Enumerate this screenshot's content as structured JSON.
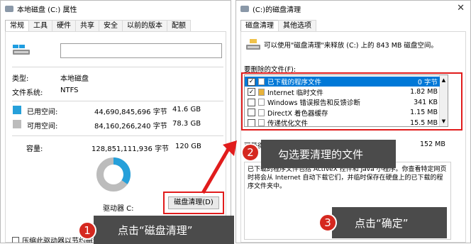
{
  "left_window": {
    "title": "本地磁盘 (C:) 属性",
    "tabs": [
      "常规",
      "工具",
      "硬件",
      "共享",
      "安全",
      "以前的版本",
      "配额"
    ],
    "drive_name_value": "",
    "type_label": "类型:",
    "type_value": "本地磁盘",
    "fs_label": "文件系统:",
    "fs_value": "NTFS",
    "used_label": "已用空间:",
    "used_bytes": "44,690,845,696 字节",
    "used_gb": "41.6 GB",
    "free_label": "可用空间:",
    "free_bytes": "84,160,266,240 字节",
    "free_gb": "78.3 GB",
    "capacity_label": "容量:",
    "capacity_bytes": "128,851,111,936 字节",
    "capacity_gb": "120 GB",
    "drive_label": "驱动器 C:",
    "cleanup_button": "磁盘清理(D)",
    "compress_label": "压缩此驱动器以节约磁盘空间(C)",
    "used_fraction": 0.347,
    "colors": {
      "used": "#26a0da",
      "free": "#bcbcbc"
    }
  },
  "right_window": {
    "title": "(C:)的磁盘清理",
    "tabs": [
      "磁盘清理",
      "其他选项"
    ],
    "summary": "可以使用\"磁盘清理\"来释放 (C:) 上的 843 MB 磁盘空间。",
    "files_label": "要删除的文件(F):",
    "files": [
      {
        "name": "已下载的程序文件",
        "size": "0 字节",
        "checked": true,
        "selected": true
      },
      {
        "name": "Internet 临时文件",
        "size": "1.82 MB",
        "checked": true,
        "selected": false
      },
      {
        "name": "Windows 错误报告和反馈诊断",
        "size": "341 KB",
        "checked": false,
        "selected": false
      },
      {
        "name": "DirectX 着色器缓存",
        "size": "1.15 MB",
        "checked": false,
        "selected": false
      },
      {
        "name": "传递优化文件",
        "size": "15.5 MB",
        "checked": false,
        "selected": false
      }
    ],
    "gain_label": "可获得的磁盘空间总量:",
    "gain_value": "152 MB",
    "description": "已下载的程序文件包括 ActiveX 控件和 Java 小程序。你查看特定网页时将会从 Internet 自动下载它们，并临时保存在硬盘上的已下载的程序文件夹中。"
  },
  "callouts": [
    {
      "num": "1",
      "text": "点击“磁盘清理”"
    },
    {
      "num": "2",
      "text": "勾选要清理的文件"
    },
    {
      "num": "3",
      "text": "点击“确定”"
    }
  ],
  "accent_red": "#e11c1c"
}
